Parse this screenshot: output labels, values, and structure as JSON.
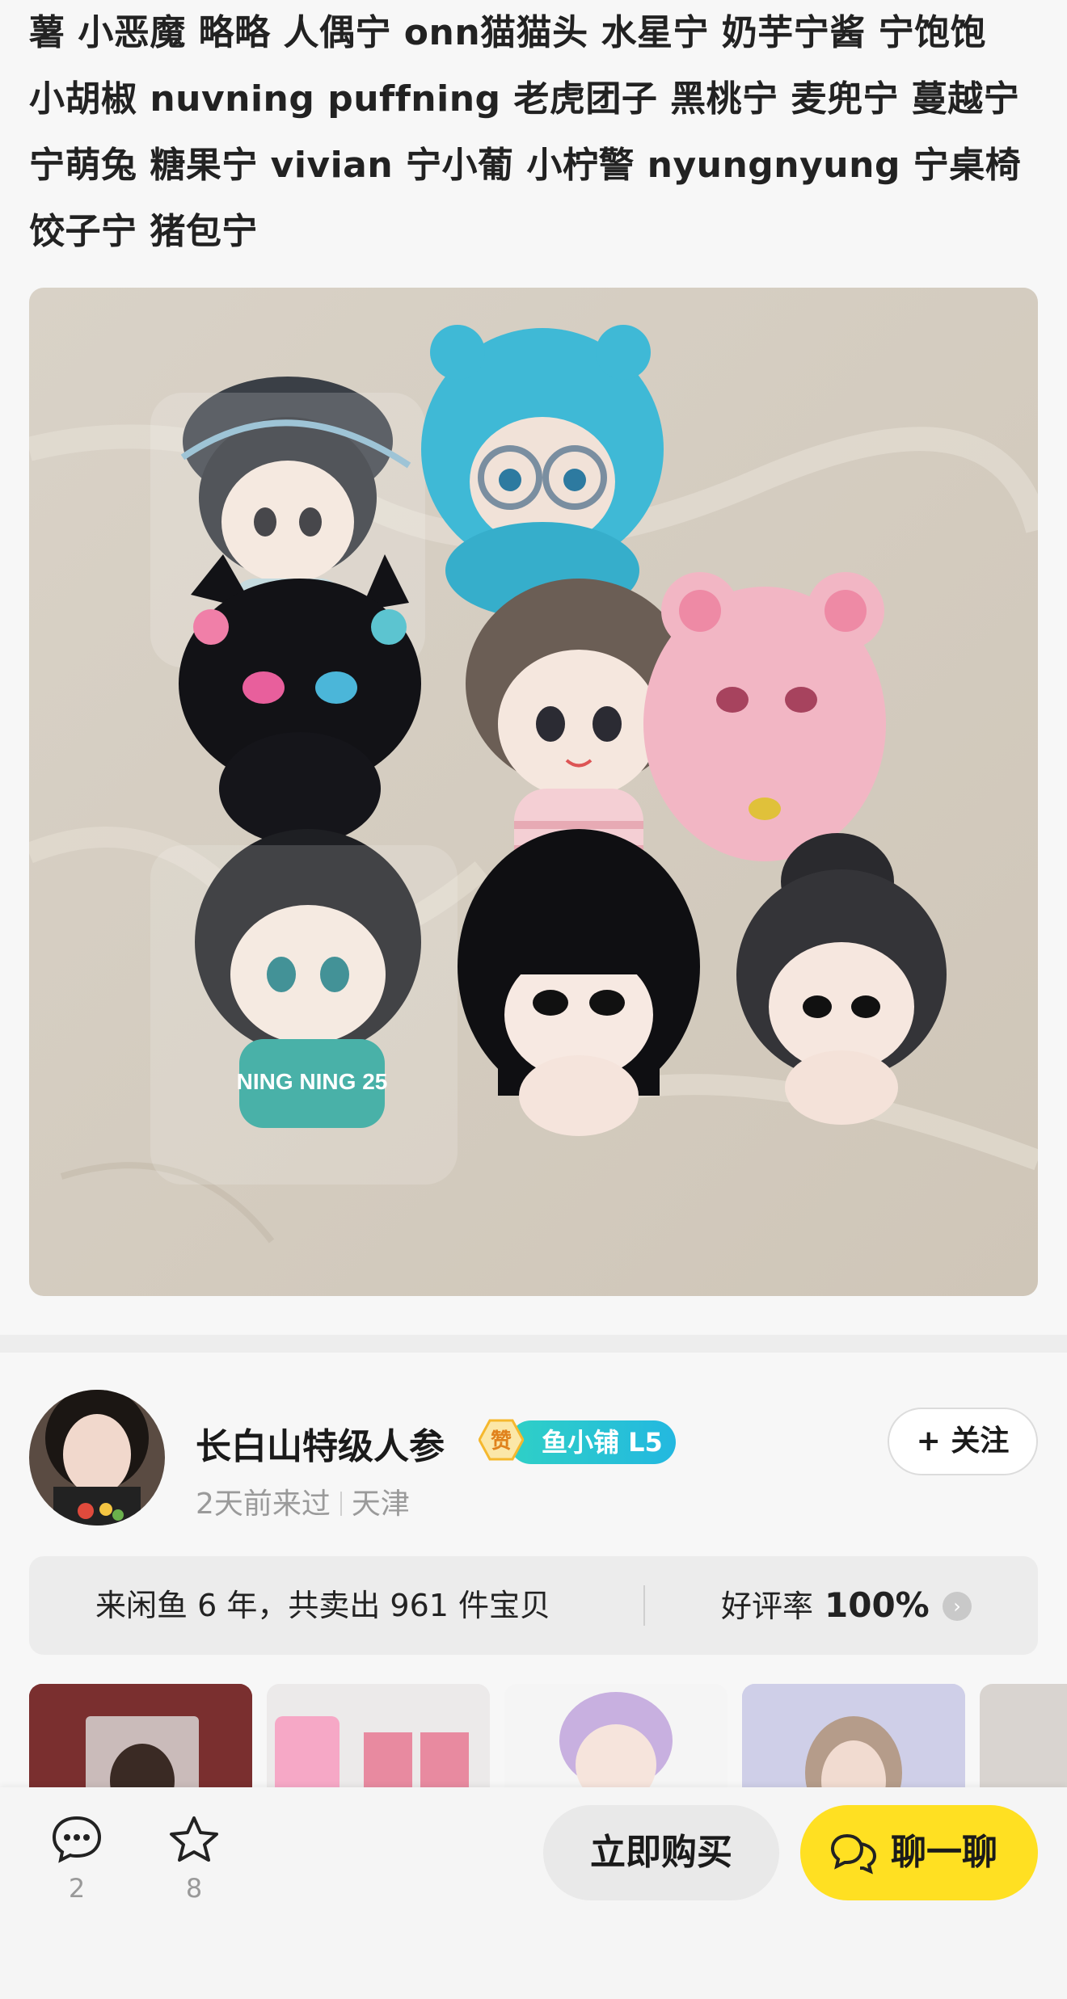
{
  "description": {
    "lines": [
      "薯 小恶魔 略略 人偶宁 onn猫猫头 水星宁 奶芋宁酱 宁饱饱",
      "小胡椒 nuvning puffning 老虎团子 黑桃宁 麦兜宁 蔓越宁",
      "宁萌兔 糖果宁 vivian 宁小葡 小柠警 nyungnyung 宁桌椅",
      "饺子宁 猪包宁"
    ]
  },
  "photo": {
    "doll_jersey_text": "NING NING 25"
  },
  "seller": {
    "name": "长白山特级人参",
    "badge_zan": "赞",
    "badge_shop": "鱼小铺 L5",
    "last_seen": "2天前来过",
    "location": "天津",
    "follow_label": "+ 关注"
  },
  "stats": {
    "summary": "来闲鱼 6 年，共卖出 961 件宝贝",
    "rating_label": "好评率",
    "rating_value": "100%"
  },
  "thumbnails": [
    {
      "name": "photocard-item"
    },
    {
      "name": "pink-keychain-item"
    },
    {
      "name": "doll-plush-item"
    },
    {
      "name": "portrait-card-item"
    }
  ],
  "bottom_bar": {
    "comments_count": "2",
    "favorites_count": "8",
    "buy_label": "立即购买",
    "chat_label": "聊一聊"
  },
  "colors": {
    "accent_yellow": "#ffe022",
    "shop_badge": "#23b8e0",
    "zan_badge": "#f5b82e"
  }
}
